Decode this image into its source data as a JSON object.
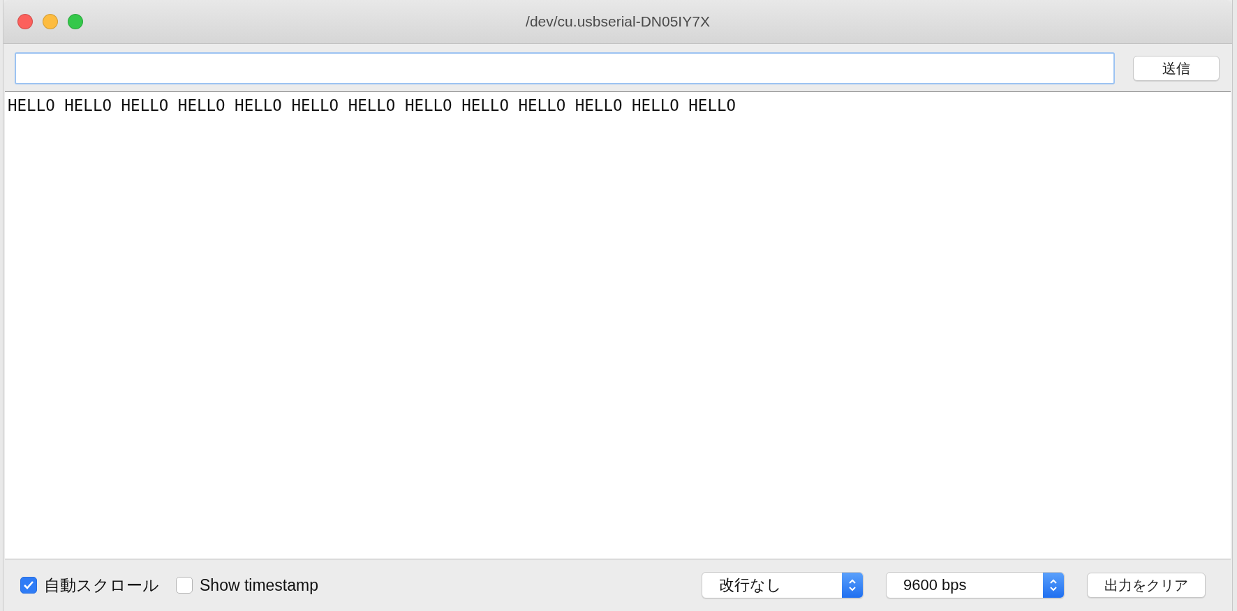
{
  "window": {
    "title": "/dev/cu.usbserial-DN05IY7X"
  },
  "send_button": {
    "label": "送信"
  },
  "output": {
    "text": "HELLO HELLO HELLO HELLO HELLO HELLO HELLO HELLO HELLO HELLO HELLO HELLO HELLO"
  },
  "options": [
    {
      "label": "自動スクロール",
      "checked": true
    },
    {
      "label": "Show timestamp",
      "checked": false
    }
  ],
  "selects": [
    {
      "value": "改行なし"
    },
    {
      "value": "9600 bps"
    }
  ],
  "clear_button": {
    "label": "出力をクリア"
  }
}
